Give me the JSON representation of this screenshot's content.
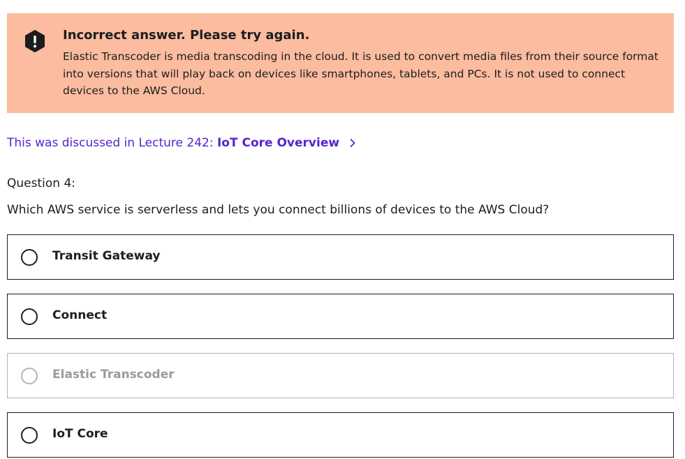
{
  "feedback": {
    "status": "incorrect",
    "icon": "alert-circle-icon",
    "title": "Incorrect answer. Please try again.",
    "explanation": "Elastic Transcoder is media transcoding in the cloud. It is used to convert media files from their source format into versions that will play back on devices like smartphones, tablets, and PCs. It is not used to connect devices to the AWS Cloud.",
    "background_color": "#fbbc9f"
  },
  "lecture": {
    "prefix": "This was discussed in Lecture 242: ",
    "title": "IoT Core Overview",
    "icon": "chevron-right-icon",
    "link_color": "#5624d0"
  },
  "question": {
    "number_label": "Question 4:",
    "text": "Which AWS service is serverless and lets you connect billions of devices to the AWS Cloud?"
  },
  "options": [
    {
      "label": "Transit Gateway",
      "disabled": false
    },
    {
      "label": "Connect",
      "disabled": false
    },
    {
      "label": "Elastic Transcoder",
      "disabled": true
    },
    {
      "label": "IoT Core",
      "disabled": false
    }
  ]
}
